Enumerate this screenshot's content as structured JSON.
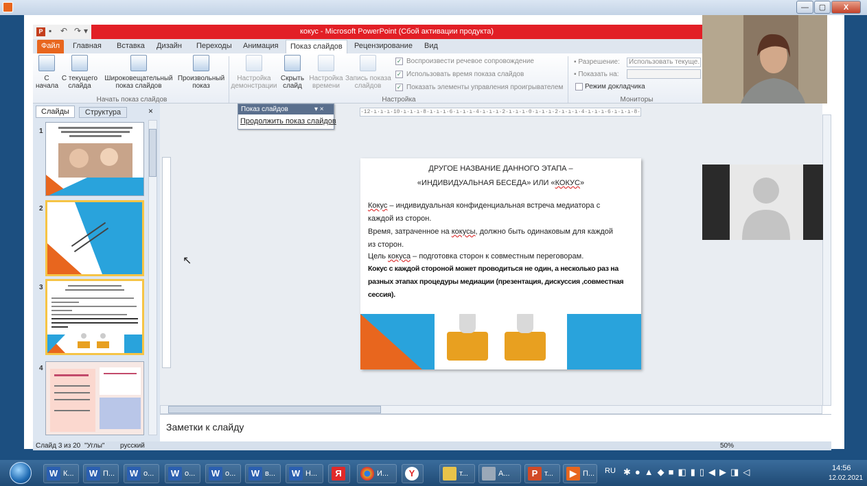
{
  "ppt": {
    "title": "кокус - Microsoft PowerPoint (Сбой активации продукта)",
    "tabs": [
      "Файл",
      "Главная",
      "Вставка",
      "Дизайн",
      "Переходы",
      "Анимация",
      "Показ слайдов",
      "Рецензирование",
      "Вид"
    ]
  },
  "ribbon": {
    "from_start": "С\nначала",
    "from_current": "С текущего\nслайда",
    "broadcast": "Широковещательный\nпоказ слайдов",
    "custom": "Произвольный\nпоказ",
    "group_start": "Начать показ слайдов",
    "setup": "Настройка\nдемонстрации",
    "hide": "Скрыть\nслайд",
    "rehearse": "Настройка\nвремени",
    "record": "Запись показа\nслайдов",
    "chk_narration": "Воспроизвести речевое сопровождение",
    "chk_timings": "Использовать время показа слайдов",
    "chk_controls": "Показать элементы управления проигрывателем",
    "group_setup": "Настройка",
    "mon_resolution_label": "Разрешение:",
    "mon_resolution_value": "Использовать текуще...",
    "mon_show_on": "Показать на:",
    "mon_presenter": "Режим докладчика",
    "group_monitors": "Мониторы"
  },
  "panel": {
    "tab_slides": "Слайды",
    "tab_outline": "Структура",
    "close": "×",
    "numbers": [
      "1",
      "2",
      "3",
      "4"
    ]
  },
  "float": {
    "title": "Показ слайдов",
    "buttons": "▾ ×",
    "resume": "Продолжить показ слайдов"
  },
  "ruler": "·12·ı·ı·ı·10·ı·ı·ı·8·ı·ı·ı·6·ı·ı·ı·4·ı·ı·ı·2·ı·ı·ı·0·ı·ı·ı·2·ı·ı·ı·4·ı·ı·ı·6·ı·ı·ı·8·ı·ı·ı·10·ı·ı·ı·12·",
  "slide": {
    "title1": "ДРУГОЕ НАЗВАНИЕ ДАННОГО ЭТАПА –",
    "title2_pre": "«ИНДИВИДУАЛЬНАЯ  БЕСЕДА» ИЛИ «",
    "title2_word": "КОКУС",
    "title2_post": "»",
    "p1_word": "Кокус",
    "p1_rest": " – индивидуальная  конфиденциальная  встреча медиатора  с",
    "p1_line2": "каждой из сторон.",
    "p2_pre": "Время, затраченное  на ",
    "p2_word": "кокусы",
    "p2_rest": ", должно быть одинаковым для каждой",
    "p2_line2": "из сторон.",
    "p3_pre": "Цель ",
    "p3_word": "кокуса",
    "p3_rest": " – подготовка сторон  к совместным  переговорам.",
    "b1": "Кокус с каждой стороной может проводиться не один, а несколько раз на",
    "b2": "разных этапах процедуры медиации (презентация, дискуссия ,совместная",
    "b3": "сессия)."
  },
  "notes": "Заметки к слайду",
  "status": {
    "slide": "Слайд 3 из 20",
    "theme": "\"Углы\"",
    "lang": "русский",
    "zoom": "50%"
  },
  "taskbar": {
    "items": [
      "К...",
      "П...",
      "о...",
      "о...",
      "о...",
      "в...",
      "Н...",
      "",
      "И...",
      "",
      "т...",
      "А...",
      "т...",
      "П..."
    ],
    "lang": "RU",
    "time": "14:56",
    "date": "12.02.2021"
  },
  "outer_window": {
    "minimize": "—",
    "maximize": "▢",
    "close": "X"
  },
  "colors": {
    "accent_orange": "#e8661e",
    "accent_blue": "#29a3dc",
    "title_red": "#e21f26"
  }
}
